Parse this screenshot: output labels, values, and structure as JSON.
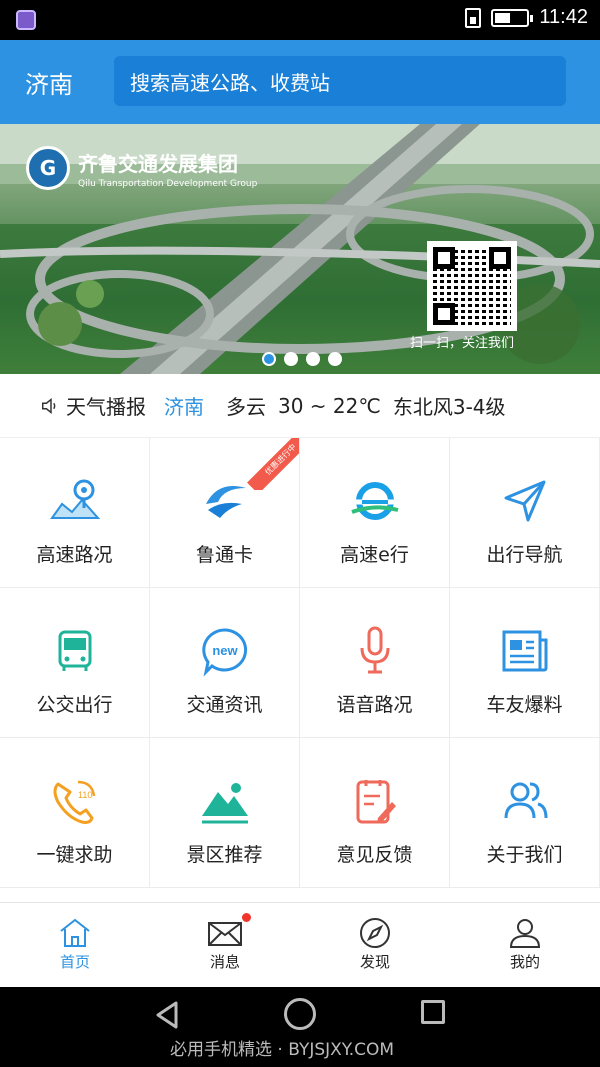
{
  "status_bar": {
    "time": "11:42",
    "battery_level": 0.5
  },
  "header": {
    "city": "济南",
    "search_placeholder": "搜索高速公路、收费站"
  },
  "banner": {
    "brand_cn": "齐鲁交通发展集团",
    "brand_en": "Qilu Transportation Development Group",
    "qr_caption": "扫一扫，关注我们",
    "slide_count": 4,
    "active_slide": 1
  },
  "weather": {
    "label": "天气播报",
    "city": "济南",
    "condition": "多云",
    "temperature": "30 ~ 22℃",
    "wind": "东北风3-4级"
  },
  "services": [
    {
      "label": "高速路况",
      "icon": "map-pin-icon"
    },
    {
      "label": "鲁通卡",
      "icon": "lutong-card-icon",
      "ribbon": "优惠进行中"
    },
    {
      "label": "高速e行",
      "icon": "e-travel-icon"
    },
    {
      "label": "出行导航",
      "icon": "navigation-arrow-icon"
    },
    {
      "label": "公交出行",
      "icon": "bus-icon"
    },
    {
      "label": "交通资讯",
      "icon": "news-bubble-icon"
    },
    {
      "label": "语音路况",
      "icon": "microphone-icon"
    },
    {
      "label": "车友爆料",
      "icon": "newspaper-icon"
    },
    {
      "label": "一键求助",
      "icon": "phone-110-icon"
    },
    {
      "label": "景区推荐",
      "icon": "mountain-icon"
    },
    {
      "label": "意见反馈",
      "icon": "clipboard-edit-icon"
    },
    {
      "label": "关于我们",
      "icon": "users-icon"
    }
  ],
  "tabs": [
    {
      "label": "首页",
      "icon": "home-icon",
      "active": true
    },
    {
      "label": "消息",
      "icon": "mail-icon",
      "has_badge": true
    },
    {
      "label": "发现",
      "icon": "compass-icon"
    },
    {
      "label": "我的",
      "icon": "user-icon"
    }
  ],
  "colors": {
    "primary": "#2d92e1",
    "badge": "#f2352a"
  },
  "watermark": "必用手机精选 · BYJSJXY.COM"
}
